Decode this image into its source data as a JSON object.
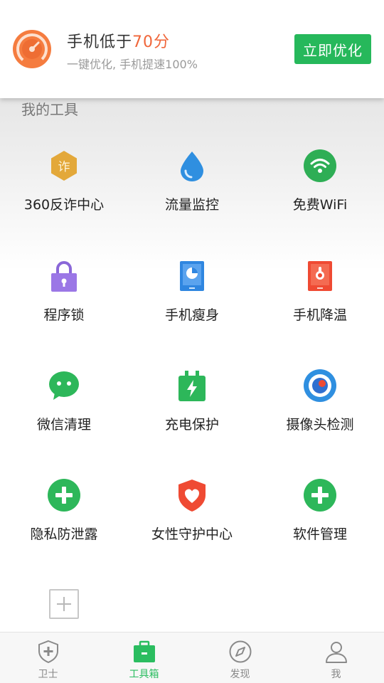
{
  "score_card": {
    "title_prefix": "手机低于",
    "title_highlight": "70分",
    "subtitle": "一键优化, 手机提速100%",
    "button_label": "立即优化"
  },
  "section_title": "我的工具",
  "tools": [
    {
      "label": "360反诈中心",
      "icon": "anti-fraud-icon"
    },
    {
      "label": "流量监控",
      "icon": "water-drop-icon"
    },
    {
      "label": "免费WiFi",
      "icon": "wifi-icon"
    },
    {
      "label": "程序锁",
      "icon": "lock-icon"
    },
    {
      "label": "手机瘦身",
      "icon": "phone-slim-icon"
    },
    {
      "label": "手机降温",
      "icon": "thermometer-icon"
    },
    {
      "label": "微信清理",
      "icon": "wechat-icon"
    },
    {
      "label": "充电保护",
      "icon": "charging-icon"
    },
    {
      "label": "摄像头检测",
      "icon": "camera-icon"
    },
    {
      "label": "隐私防泄露",
      "icon": "plus-circle-icon"
    },
    {
      "label": "女性守护中心",
      "icon": "heart-shield-icon"
    },
    {
      "label": "软件管理",
      "icon": "plus-circle-icon"
    }
  ],
  "add_tool": {
    "icon": "add-icon"
  },
  "bottom_nav": [
    {
      "label": "卫士",
      "icon": "shield-icon",
      "active": false
    },
    {
      "label": "工具箱",
      "icon": "toolbox-icon",
      "active": true
    },
    {
      "label": "发现",
      "icon": "compass-icon",
      "active": false
    },
    {
      "label": "我",
      "icon": "person-icon",
      "active": false
    }
  ],
  "colors": {
    "accent_green": "#26b85b",
    "score_orange": "#f0663a",
    "nav_active": "#2bbd60"
  }
}
